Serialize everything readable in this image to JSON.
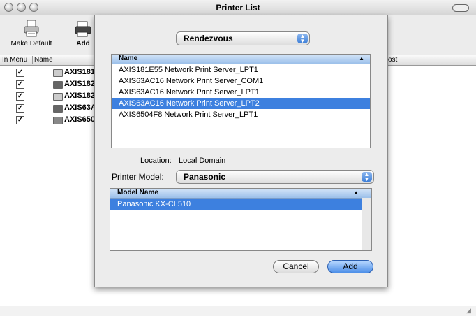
{
  "window": {
    "title": "Printer List"
  },
  "toolbar": {
    "make_default": "Make Default",
    "add": "Add"
  },
  "columns": {
    "in_menu": "In Menu",
    "name": "Name",
    "host": "ost"
  },
  "printers": [
    {
      "name": "AXIS181",
      "checked": true
    },
    {
      "name": "AXIS182",
      "checked": true
    },
    {
      "name": "AXIS182",
      "checked": true
    },
    {
      "name": "AXIS63A",
      "checked": true
    },
    {
      "name": "AXIS650",
      "checked": true
    }
  ],
  "sheet": {
    "connection_popup": "Rendezvous",
    "printer_list": {
      "header": "Name",
      "rows": [
        "AXIS181E55 Network Print Server_LPT1",
        "AXIS63AC16 Network Print Server_COM1",
        "AXIS63AC16 Network Print Server_LPT1",
        "AXIS63AC16 Network Print Server_LPT2",
        "AXIS6504F8 Network Print Server_LPT1"
      ],
      "selected_index": 3
    },
    "location_label": "Location:",
    "location_value": "Local Domain",
    "printer_model_label": "Printer Model:",
    "printer_model_value": "Panasonic",
    "model_list": {
      "header": "Model Name",
      "rows": [
        "Panasonic KX-CL510"
      ],
      "selected_index": 0
    },
    "cancel_button": "Cancel",
    "add_button": "Add"
  }
}
